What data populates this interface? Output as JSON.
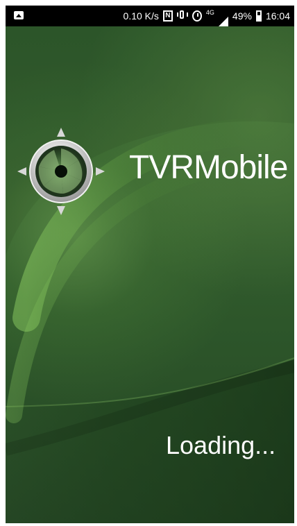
{
  "status_bar": {
    "network_speed": "0.10 K/s",
    "nfc": "N",
    "signal_label": "4G",
    "battery_percent": "49%",
    "time": "16:04"
  },
  "splash": {
    "app_name": "TVRMobile",
    "loading_text": "Loading..."
  },
  "colors": {
    "background_dark": "#254624",
    "background_mid": "#355f2f",
    "highlight": "#9bd66f",
    "text": "#ffffff"
  },
  "icons": [
    "image-notification-icon",
    "nfc-icon",
    "vibrate-icon",
    "alarm-icon",
    "signal-icon",
    "battery-icon",
    "app-logo-icon"
  ]
}
